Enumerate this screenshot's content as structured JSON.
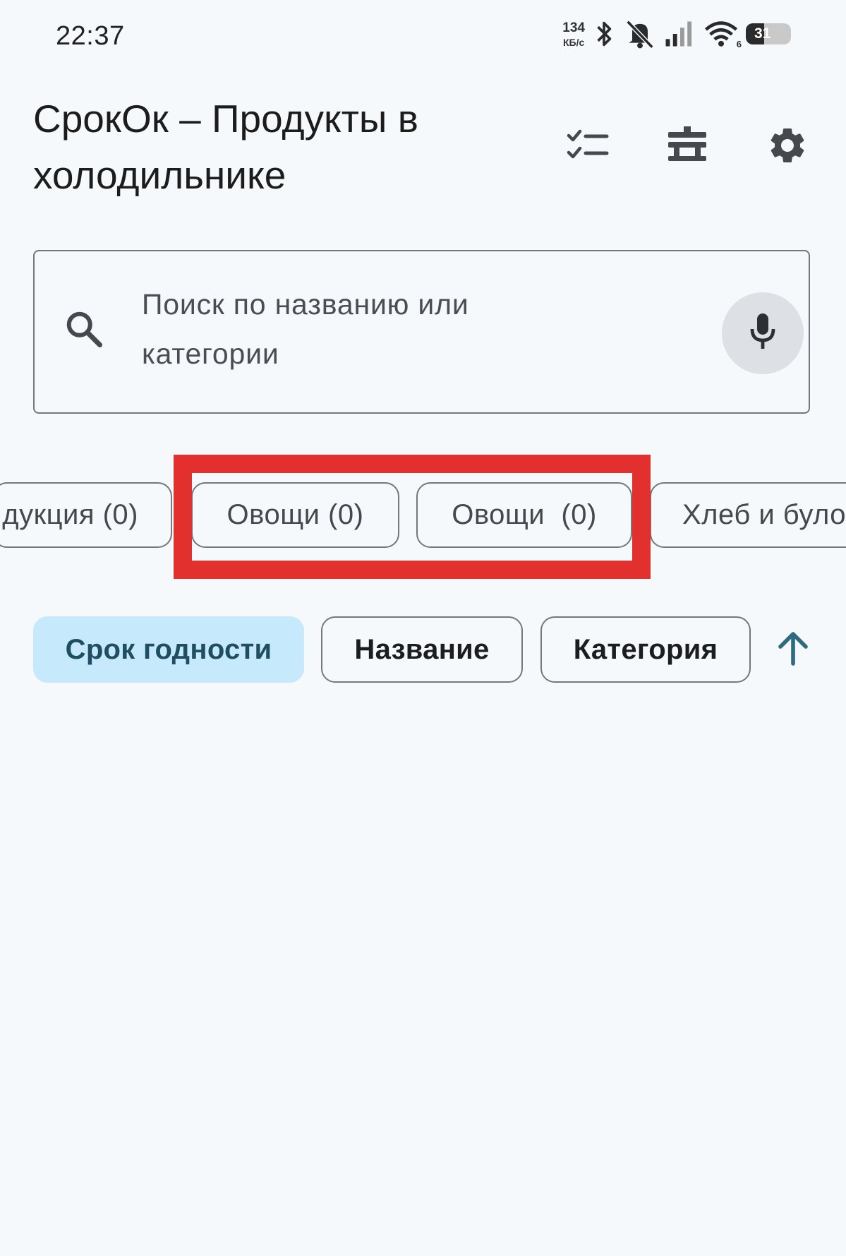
{
  "status_bar": {
    "time": "22:37",
    "net_speed_value": "134",
    "net_speed_unit": "КБ/с",
    "signal_label": "6",
    "battery": "31",
    "icons": [
      "bluetooth-icon",
      "notifications-off-icon",
      "cellular-signal-icon",
      "wifi-icon",
      "battery-icon"
    ]
  },
  "app_bar": {
    "title": "СрокОк – Продукты в холодильнике",
    "actions": [
      "checklist-icon",
      "storage-icon",
      "settings-icon"
    ]
  },
  "search": {
    "placeholder": "Поиск по названию или категории",
    "search_icon": "search-icon",
    "mic_icon": "mic-icon"
  },
  "category_chips": [
    {
      "label": "дукция (0)"
    },
    {
      "label": "Овощи (0)"
    },
    {
      "label": "Овощи  (0)"
    },
    {
      "label": "Хлеб и було"
    }
  ],
  "sort": {
    "options": [
      {
        "label": "Срок годности",
        "selected": true
      },
      {
        "label": "Название",
        "selected": false
      },
      {
        "label": "Категория",
        "selected": false
      }
    ],
    "direction_icon": "arrow-up-icon"
  },
  "colors": {
    "background": "#f5f9fc",
    "selected_chip": "#c6e9fb",
    "highlight": "#e2302f",
    "accent": "#2e6b80"
  }
}
